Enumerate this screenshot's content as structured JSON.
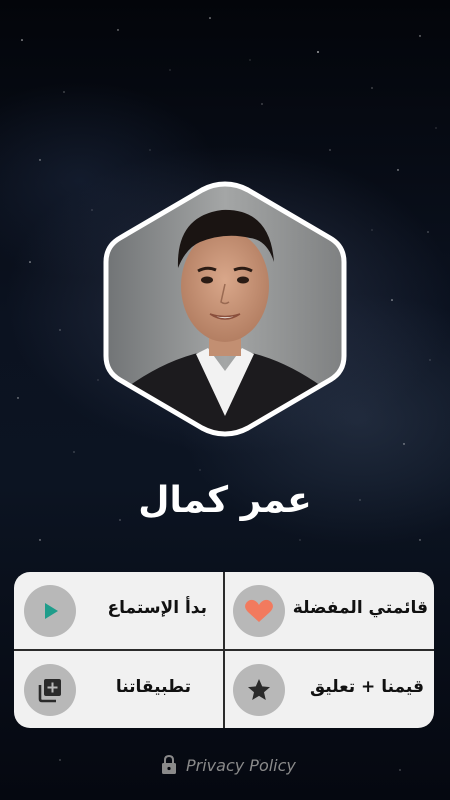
{
  "artist": {
    "name": "عمر كمال"
  },
  "menu": {
    "favorites_label": "قائمتي المفضلة",
    "start_listening_label": "بدأ الإستماع",
    "rate_comment_label": "قيمنا + تعليق",
    "our_apps_label": "تطبيقاتنا"
  },
  "footer": {
    "privacy_label": "Privacy Policy"
  },
  "colors": {
    "heart": "#f27a5e",
    "play": "#1f9d8b",
    "circle_bg": "#b8b8b8",
    "menu_bg": "#f1f1f1",
    "icon_dark": "#2a2a2a"
  },
  "icons": {
    "favorites": "heart-icon",
    "play": "play-icon",
    "rate": "star-icon",
    "apps": "add-to-library-icon",
    "privacy": "lock-icon"
  }
}
